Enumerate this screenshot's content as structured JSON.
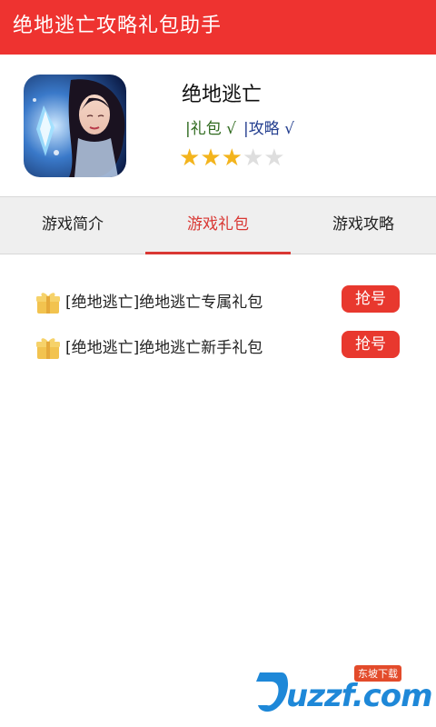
{
  "header": {
    "title": "绝地逃亡攻略礼包助手"
  },
  "game": {
    "name": "绝地逃亡",
    "tags": [
      "|礼包 √",
      "|攻略 √"
    ],
    "rating": {
      "value": 3,
      "max": 5
    }
  },
  "tabs": [
    {
      "label": "游戏简介",
      "active": false
    },
    {
      "label": "游戏礼包",
      "active": true
    },
    {
      "label": "游戏攻略",
      "active": false
    }
  ],
  "gifts": [
    {
      "name": "[绝地逃亡]绝地逃亡专属礼包",
      "button": "抢号"
    },
    {
      "name": "[绝地逃亡]绝地逃亡新手礼包",
      "button": "抢号"
    }
  ],
  "watermark": {
    "text": "uzzf.com",
    "badge": "东坡下载"
  },
  "colors": {
    "accent": "#ee3330",
    "active_tab": "#d93733",
    "star_on": "#f3b41d",
    "star_off": "#dedede"
  }
}
